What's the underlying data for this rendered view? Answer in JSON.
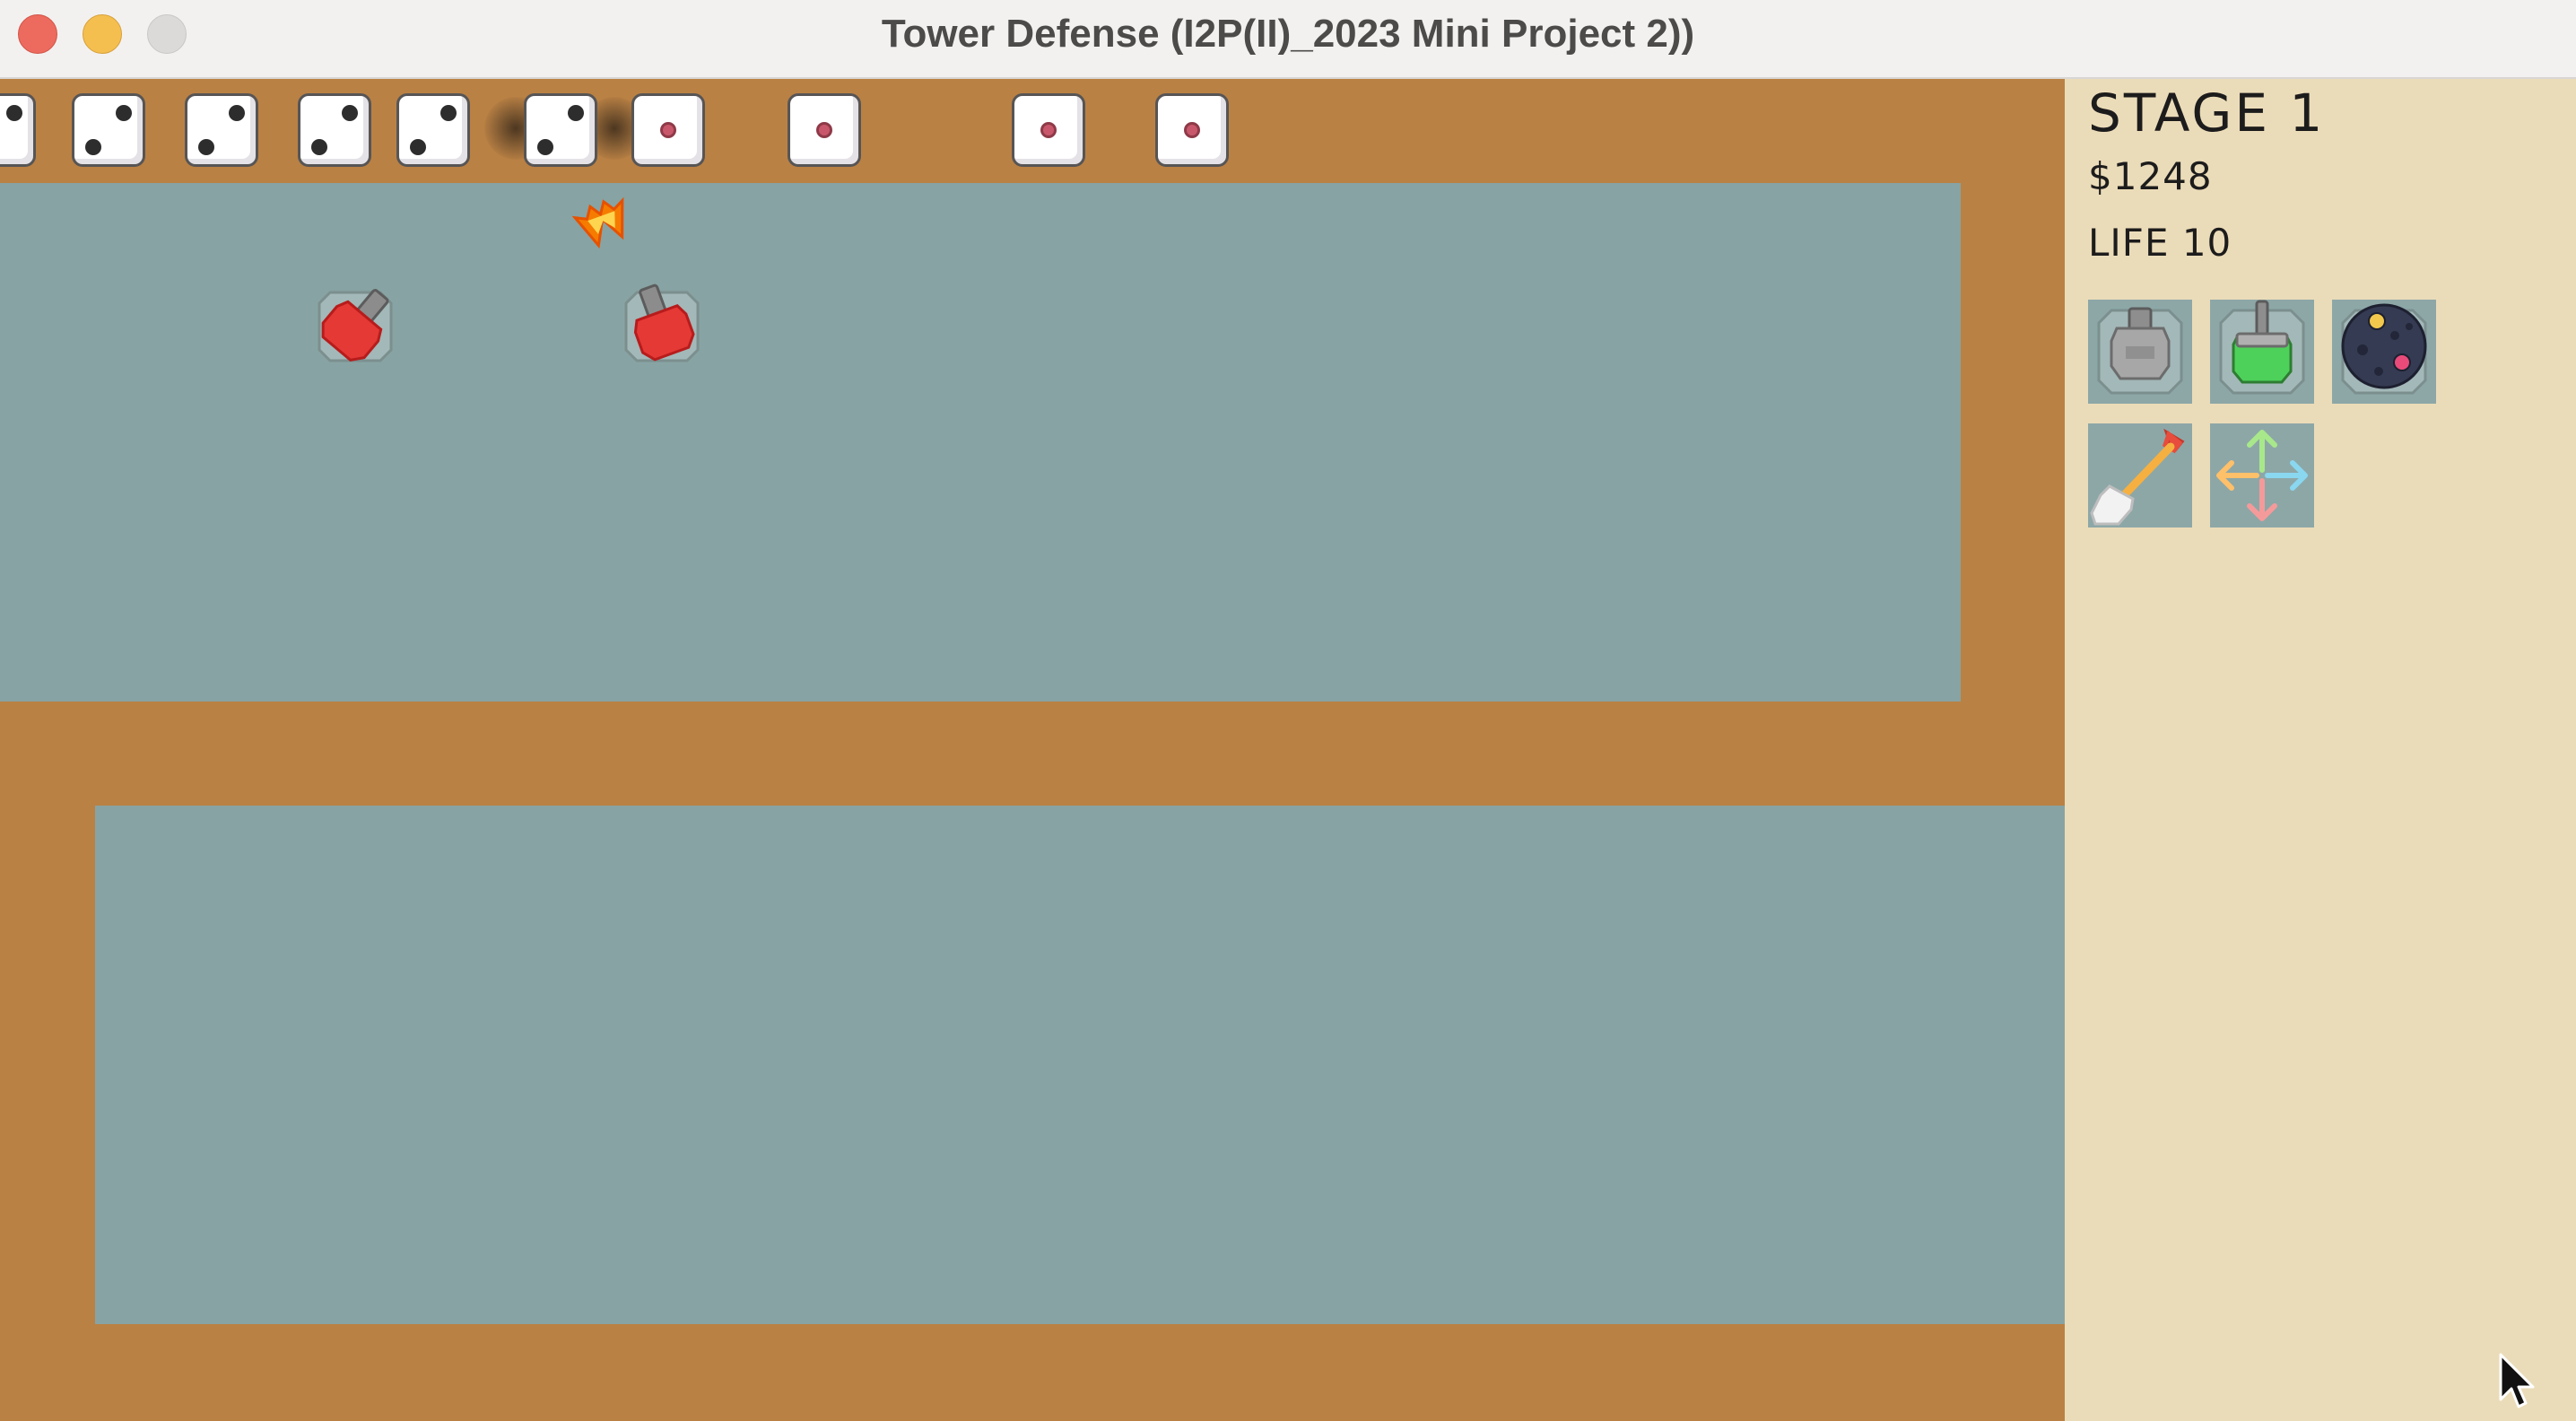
{
  "window": {
    "title": "Tower Defense (I2P(II)_2023 Mini Project 2))"
  },
  "hud": {
    "stage": "STAGE 1",
    "money": "$1248",
    "life": "LIFE 10"
  },
  "shop": {
    "items": [
      {
        "icon": "machine-gun-turret-icon",
        "color": "#9a9a9a"
      },
      {
        "icon": "laser-turret-icon",
        "color": "#52c75a"
      },
      {
        "icon": "missile-mine-icon",
        "color": "#353b52"
      },
      {
        "icon": "shovel-icon",
        "color": "#f0f0f0"
      },
      {
        "icon": "move-arrows-icon",
        "color": "#ffb35c"
      }
    ]
  },
  "enemies": {
    "count": 10,
    "kinds": [
      "two-pip-dice",
      "one-pip-dice"
    ]
  },
  "colors": {
    "path": "#ba8144",
    "floor": "#88a3a3",
    "panel": "#ebdcb9",
    "turret_red": "#e53935"
  }
}
